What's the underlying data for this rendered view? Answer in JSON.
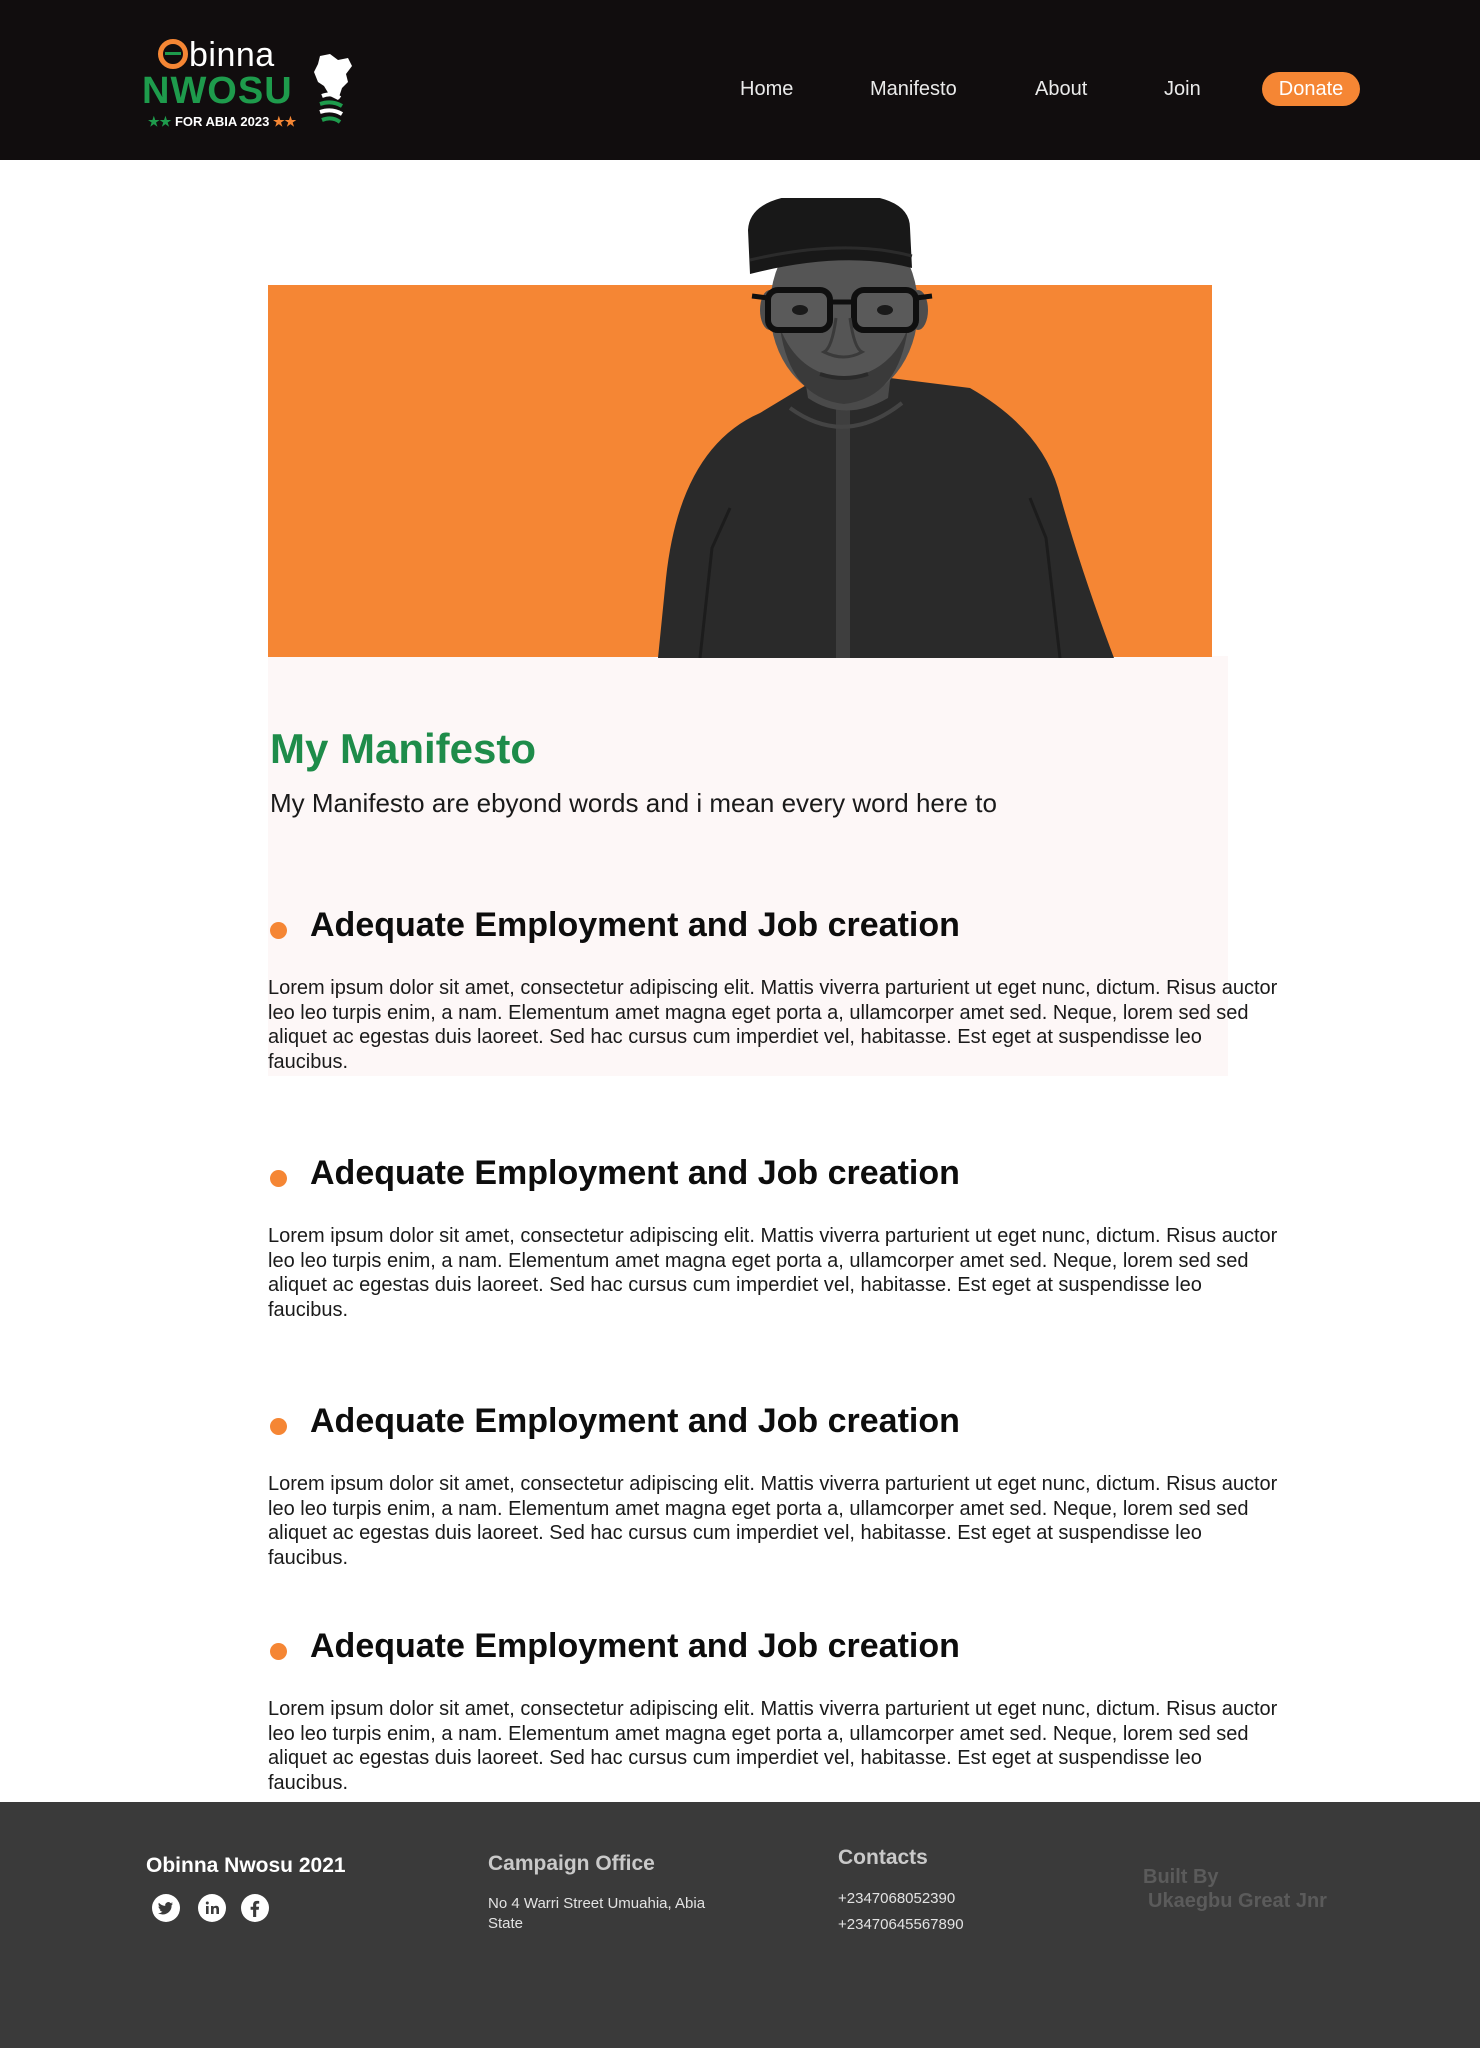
{
  "brand": {
    "logo_first": "binna",
    "logo_last": "NWOSU",
    "logo_tagline": "FOR ABIA 2023"
  },
  "nav": {
    "items": [
      "Home",
      "Manifesto",
      "About",
      "Join"
    ],
    "donate_label": "Donate"
  },
  "colors": {
    "accent_orange": "#f58634",
    "brand_green": "#1e8c4a",
    "header_bg": "#110d0e",
    "footer_bg": "#3a3a3a"
  },
  "hero": {
    "image": "candidate-portrait"
  },
  "manifesto": {
    "title": "My Manifesto",
    "subtitle": "My Manifesto are ebyond words and i mean every word here to",
    "points": [
      {
        "heading": "Adequate Employment and Job creation",
        "body": "Lorem ipsum dolor sit amet, consectetur adipiscing elit. Mattis viverra parturient ut eget nunc, dictum. Risus auctor leo leo turpis enim, a nam. Elementum amet magna eget porta a, ullamcorper amet sed. Neque, lorem sed sed aliquet ac egestas duis laoreet. Sed hac cursus cum imperdiet vel, habitasse. Est eget at suspendisse leo faucibus."
      },
      {
        "heading": "Adequate Employment and Job creation",
        "body": "Lorem ipsum dolor sit amet, consectetur adipiscing elit. Mattis viverra parturient ut eget nunc, dictum. Risus auctor leo leo turpis enim, a nam. Elementum amet magna eget porta a, ullamcorper amet sed. Neque, lorem sed sed aliquet ac egestas duis laoreet. Sed hac cursus cum imperdiet vel, habitasse. Est eget at suspendisse leo faucibus."
      },
      {
        "heading": "Adequate Employment and Job creation",
        "body": "Lorem ipsum dolor sit amet, consectetur adipiscing elit. Mattis viverra parturient ut eget nunc, dictum. Risus auctor leo leo turpis enim, a nam. Elementum amet magna eget porta a, ullamcorper amet sed. Neque, lorem sed sed aliquet ac egestas duis laoreet. Sed hac cursus cum imperdiet vel, habitasse. Est eget at suspendisse leo faucibus."
      },
      {
        "heading": "Adequate Employment and Job creation",
        "body": "Lorem ipsum dolor sit amet, consectetur adipiscing elit. Mattis viverra parturient ut eget nunc, dictum. Risus auctor leo leo turpis enim, a nam. Elementum amet magna eget porta a, ullamcorper amet sed. Neque, lorem sed sed aliquet ac egestas duis laoreet. Sed hac cursus cum imperdiet vel, habitasse. Est eget at suspendisse leo faucibus."
      }
    ]
  },
  "footer": {
    "brand": "Obinna Nwosu 2021",
    "socials": [
      "twitter-icon",
      "linkedin-icon",
      "facebook-icon"
    ],
    "office_heading": "Campaign Office",
    "office_address": "No 4 Warri Street Umuahia, Abia State",
    "contacts_heading": "Contacts",
    "phones": [
      "+2347068052390",
      "+23470645567890"
    ],
    "built_by_label": "Built By",
    "built_by_name": "Ukaegbu Great Jnr"
  }
}
